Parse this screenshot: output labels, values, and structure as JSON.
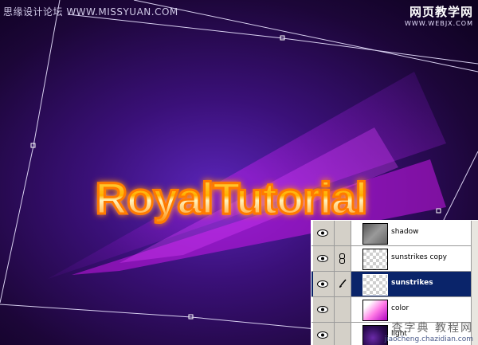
{
  "canvas": {
    "title_text": "RoyalTutorial"
  },
  "watermarks": {
    "top_left": "思缘设计论坛 WWW.MISSYUAN.COM",
    "top_right_line1": "网页教学网",
    "top_right_line2": "WWW.WEBJX.COM",
    "bottom_right_line1": "查字典 教程网",
    "bottom_right_line2": "jiaocheng.chazidian.com"
  },
  "layers_panel": {
    "layers": [
      {
        "name": "shadow",
        "thumb": "shadow",
        "selected": false,
        "link": "none"
      },
      {
        "name": "sunstrikes copy",
        "thumb": "transparent",
        "selected": false,
        "link": "chain-icon"
      },
      {
        "name": "sunstrikes",
        "thumb": "transparent",
        "selected": true,
        "link": "brush-icon"
      },
      {
        "name": "color",
        "thumb": "color",
        "selected": false,
        "link": "none"
      },
      {
        "name": "light",
        "thumb": "light",
        "selected": false,
        "link": "none"
      }
    ]
  },
  "colors": {
    "background_dark": "#1a0830",
    "background_glow": "#4a1a9a",
    "beam": "#d020f0",
    "text_fill": "#ffb000",
    "text_outline": "#ff7a00",
    "selection": "#0a246a"
  }
}
